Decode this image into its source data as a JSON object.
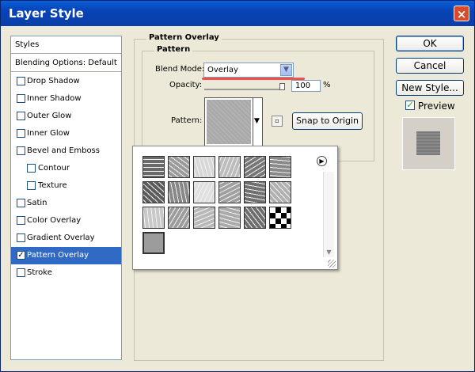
{
  "window": {
    "title": "Layer Style",
    "close_glyph": "×"
  },
  "styles_list": {
    "header": "Styles",
    "blending": "Blending Options: Default",
    "items": [
      {
        "label": "Drop Shadow",
        "checked": false,
        "indent": false
      },
      {
        "label": "Inner Shadow",
        "checked": false,
        "indent": false
      },
      {
        "label": "Outer Glow",
        "checked": false,
        "indent": false
      },
      {
        "label": "Inner Glow",
        "checked": false,
        "indent": false
      },
      {
        "label": "Bevel and Emboss",
        "checked": false,
        "indent": false
      },
      {
        "label": "Contour",
        "checked": false,
        "indent": true
      },
      {
        "label": "Texture",
        "checked": false,
        "indent": true
      },
      {
        "label": "Satin",
        "checked": false,
        "indent": false
      },
      {
        "label": "Color Overlay",
        "checked": false,
        "indent": false
      },
      {
        "label": "Gradient Overlay",
        "checked": false,
        "indent": false
      },
      {
        "label": "Pattern Overlay",
        "checked": true,
        "indent": false,
        "selected": true
      },
      {
        "label": "Stroke",
        "checked": false,
        "indent": false
      }
    ]
  },
  "panel": {
    "outer_title": "Pattern Overlay",
    "inner_title": "Pattern",
    "blend_mode_label": "Blend Mode:",
    "blend_mode_value": "Overlay",
    "opacity_label": "Opacity:",
    "opacity_value": "100",
    "opacity_unit": "%",
    "opacity_level": 1.0,
    "pattern_label": "Pattern:",
    "snap_button": "Snap to Origin"
  },
  "buttons": {
    "ok": "OK",
    "cancel": "Cancel",
    "new_style": "New Style...",
    "preview": "Preview",
    "preview_checked": true
  },
  "colors": {
    "title_bar": "#0a4fc6",
    "selection": "#316ac5",
    "highlight_line": "#f05050",
    "dialog_bg": "#ece9d8"
  },
  "pattern_picker": {
    "tiles": [
      "dark-mesh",
      "noise-light",
      "speckle",
      "gray-noise",
      "bark",
      "stone",
      "wrinkled",
      "crumple",
      "spatter",
      "dense-noise",
      "dark-grain",
      "scratch",
      "light-noise",
      "cloth",
      "fine-grain",
      "fibers",
      "cells",
      "checker",
      "solid-gray"
    ],
    "selected_index": 18
  }
}
